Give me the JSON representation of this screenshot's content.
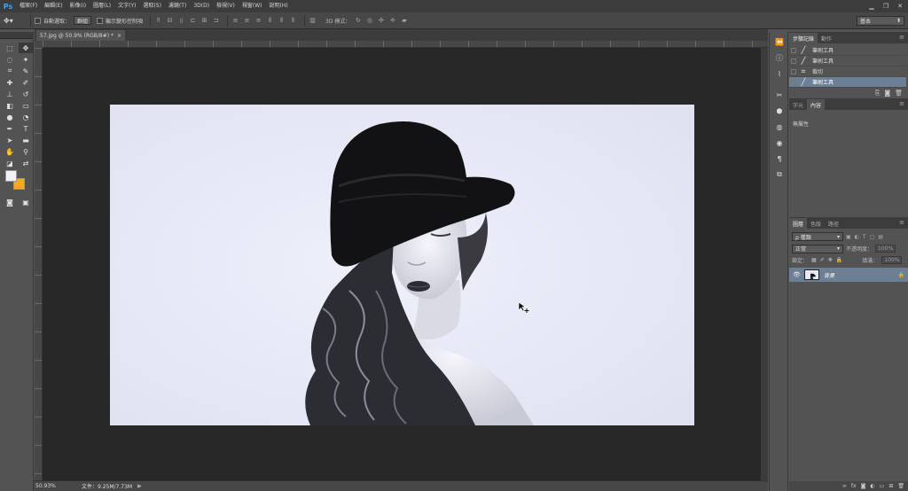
{
  "app": {
    "logo": "Ps"
  },
  "menu": [
    "檔案(F)",
    "編輯(E)",
    "影像(I)",
    "圖層(L)",
    "文字(Y)",
    "選取(S)",
    "濾鏡(T)",
    "3D(D)",
    "檢視(V)",
    "視窗(W)",
    "說明(H)"
  ],
  "window_controls": {
    "minimize": "▁",
    "restore": "❐",
    "close": "✕"
  },
  "options": {
    "auto_select_label": "自動選取：",
    "auto_select_value": "群組",
    "transform_label": "顯示變形控制項",
    "mode3d_label": "3D 模式：",
    "workspace": "基本"
  },
  "document": {
    "tab_title": "57.jpg @ 50.9% (RGB/8#) *",
    "close": "×"
  },
  "status": {
    "zoom": "50.93%",
    "file": "文件：9.25M/7.73M",
    "arrow": "▶"
  },
  "history_panel": {
    "tabs": [
      "步驟記錄",
      "動作"
    ],
    "items": [
      {
        "label": "筆刷工具",
        "icon": "brush"
      },
      {
        "label": "筆刷工具",
        "icon": "brush"
      },
      {
        "label": "裁切",
        "icon": "crop"
      },
      {
        "label": "筆刷工具",
        "icon": "brush"
      }
    ],
    "selected_index": 3
  },
  "properties_panel": {
    "tabs": [
      "字元",
      "內容"
    ],
    "empty_text": "無屬性"
  },
  "layers_panel": {
    "tabs": [
      "圖層",
      "色版",
      "路徑"
    ],
    "filter_kind": "ρ 種類",
    "blend_mode": "正常",
    "opacity_label": "不透明度：",
    "opacity_value": "100%",
    "lock_label": "鎖定：",
    "fill_label": "填滿：",
    "fill_value": "100%",
    "layers": [
      {
        "name": "背景",
        "visible": true,
        "locked": true
      }
    ]
  },
  "colors": {
    "foreground": "#f2f2f6",
    "background": "#f7a823",
    "photo_bg": "#e6e8f6",
    "selection": "#6d7f94"
  }
}
